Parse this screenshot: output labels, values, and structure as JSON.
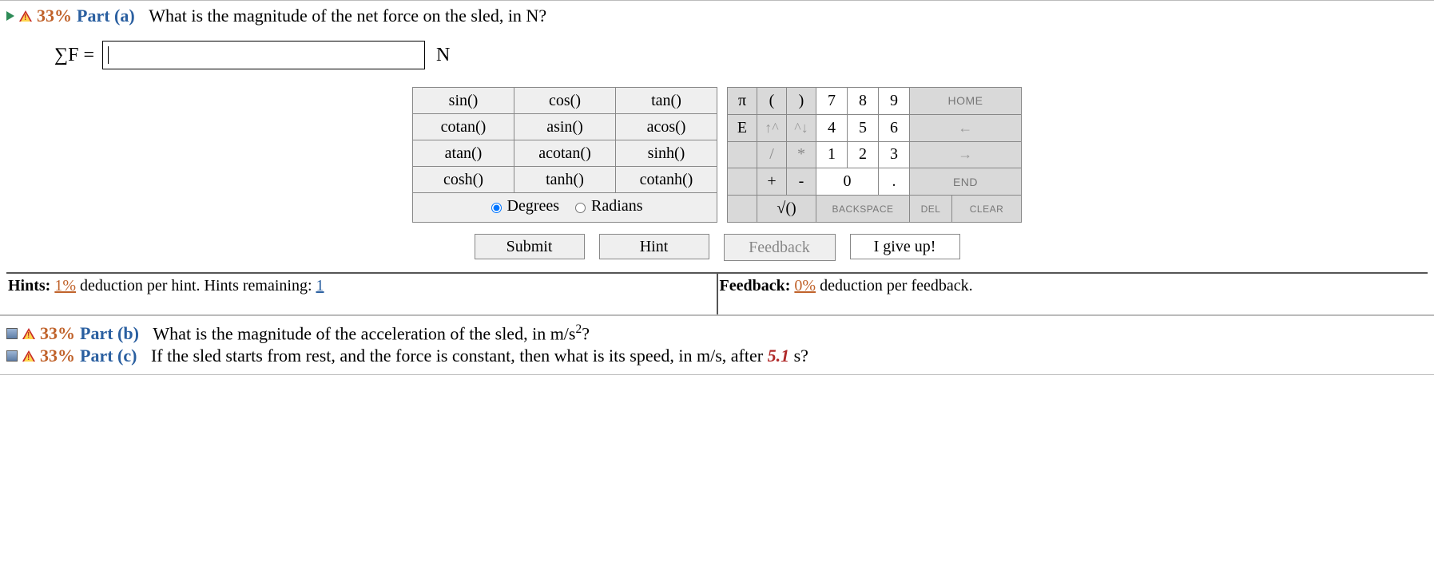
{
  "partA": {
    "percent": "33%",
    "label": "Part (a)",
    "question": "What is the magnitude of the net force on the sled, in N?",
    "sigmaF": "∑F =",
    "answer_value": "",
    "unit": "N"
  },
  "func_keys": [
    [
      "sin()",
      "cos()",
      "tan()"
    ],
    [
      "cotan()",
      "asin()",
      "acos()"
    ],
    [
      "atan()",
      "acotan()",
      "sinh()"
    ],
    [
      "cosh()",
      "tanh()",
      "cotanh()"
    ]
  ],
  "mode": {
    "degrees": "Degrees",
    "radians": "Radians",
    "selected": "degrees"
  },
  "num_keys": {
    "r1": [
      "π",
      "(",
      ")",
      "7",
      "8",
      "9",
      "HOME"
    ],
    "r2": [
      "E",
      "↑^",
      "^↓",
      "4",
      "5",
      "6",
      "←"
    ],
    "r3": [
      "",
      "/",
      "*",
      "1",
      "2",
      "3",
      "→"
    ],
    "r4": [
      "",
      "+",
      "-",
      "0",
      ".",
      "END"
    ],
    "r5": [
      "",
      "√()",
      "BACKSPACE",
      "DEL",
      "CLEAR"
    ]
  },
  "actions": {
    "submit": "Submit",
    "hint": "Hint",
    "feedback": "Feedback",
    "giveup": "I give up!"
  },
  "hints": {
    "label": "Hints:",
    "pct": "1%",
    "text1": "deduction per hint. Hints remaining:",
    "remaining": "1"
  },
  "feedback": {
    "label": "Feedback:",
    "pct": "0%",
    "text": "deduction per feedback."
  },
  "partB": {
    "percent": "33%",
    "label": "Part (b)",
    "question_1": "What is the magnitude of the acceleration of the sled, in m/s",
    "question_sup": "2",
    "question_2": "?"
  },
  "partC": {
    "percent": "33%",
    "label": "Part (c)",
    "question_1": "If the sled starts from rest, and the force is constant, then what is its speed, in m/s, after ",
    "time": "5.1",
    "question_2": " s?"
  }
}
